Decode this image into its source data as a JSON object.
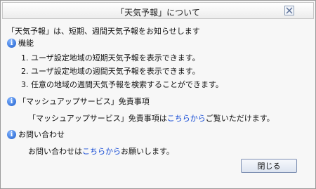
{
  "dialog": {
    "title": "「天気予報」について",
    "intro": "「天気予報」は、短期、週間天気予報をお知らせします"
  },
  "sections": {
    "features": {
      "title": "機能",
      "items": [
        {
          "num": "1.",
          "text": "ユーザ設定地域の短期天気予報を表示できます。"
        },
        {
          "num": "2.",
          "text": "ユーザ設定地域の週間天気予報を表示できます。"
        },
        {
          "num": "3.",
          "text": "任意の地域の週間天気予報を検索することができます。"
        }
      ]
    },
    "disclaimer": {
      "title": "「マッシュアップサービス」免責事項",
      "before": "「マッシュアップサービス」免責事項は",
      "link": "こちらから",
      "after": "ご覧いただけます。"
    },
    "contact": {
      "title": "お問い合わせ",
      "before": "お問い合わせは",
      "link": "こちらから",
      "after": "お願いします。"
    }
  },
  "buttons": {
    "close": "閉じる"
  },
  "icons": {
    "info": "info-icon",
    "close": "close-icon"
  },
  "colors": {
    "link": "#1a4fd6",
    "info_icon": "#1f5fcc"
  }
}
